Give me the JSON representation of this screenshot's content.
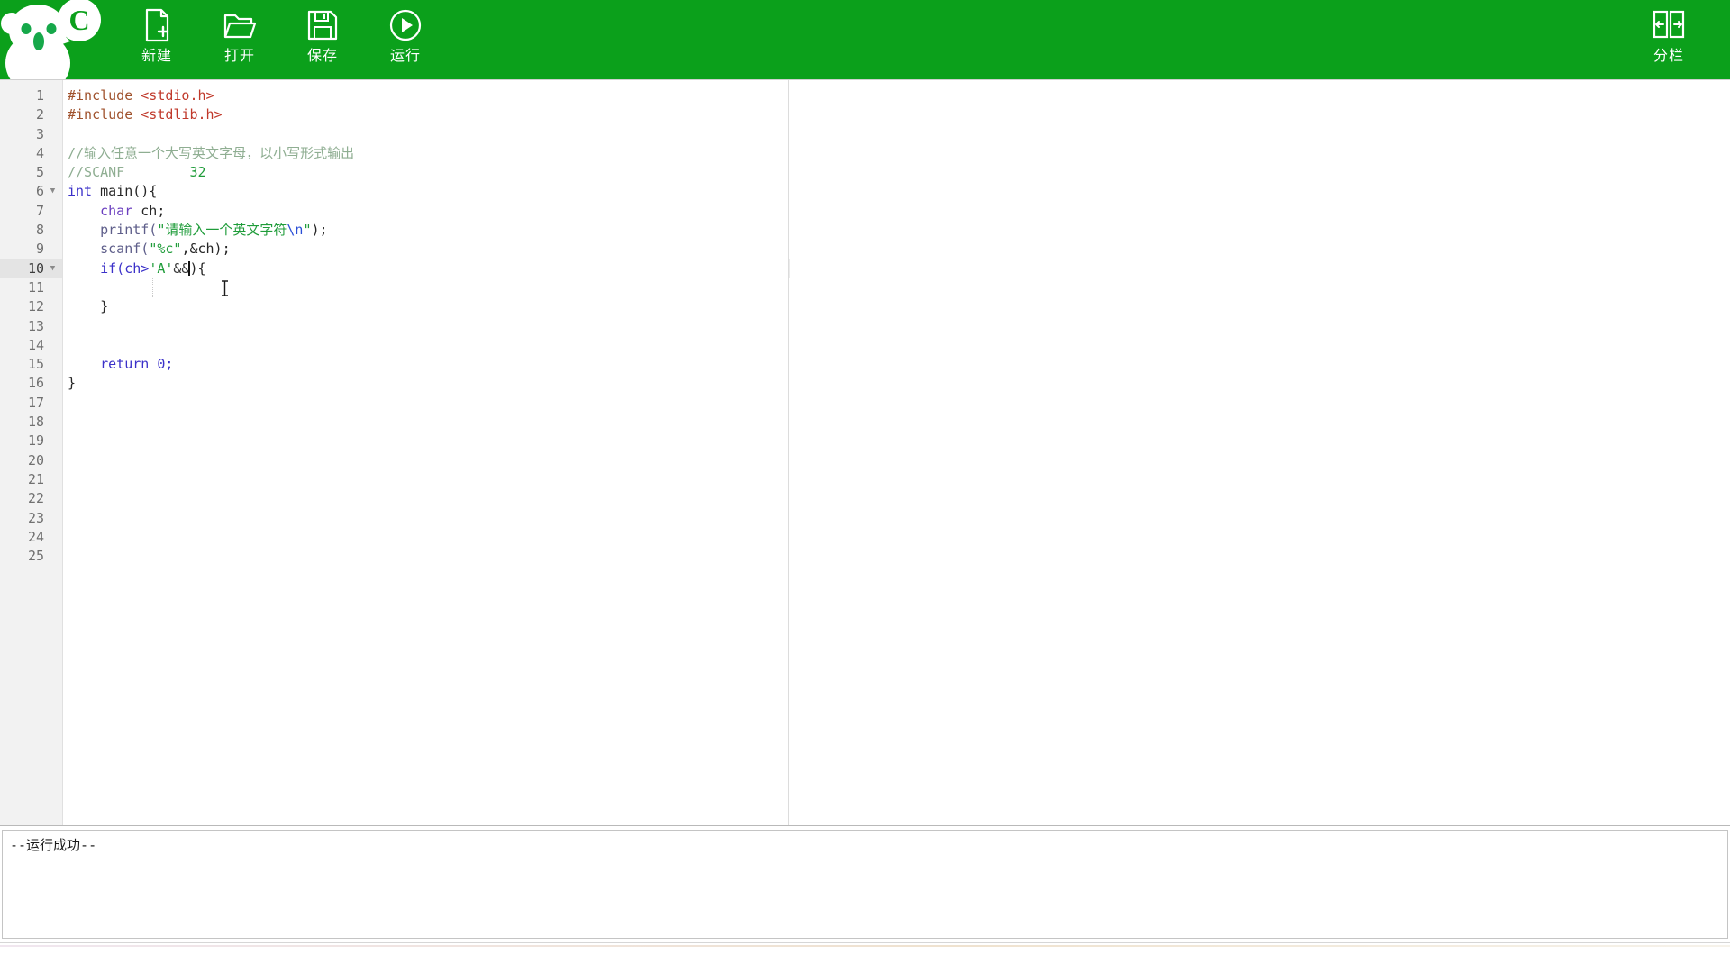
{
  "app": {
    "logo_alt": "c-mascot-logo",
    "toolbar_bg": "#0ba01b"
  },
  "toolbar": {
    "buttons": [
      {
        "id": "new",
        "label": "新建",
        "icon": "new-file-icon"
      },
      {
        "id": "open",
        "label": "打开",
        "icon": "open-folder-icon"
      },
      {
        "id": "save",
        "label": "保存",
        "icon": "floppy-save-icon"
      },
      {
        "id": "run",
        "label": "运行",
        "icon": "play-run-icon"
      }
    ],
    "split": {
      "id": "split",
      "label": "分栏",
      "icon": "split-pane-icon"
    }
  },
  "editor": {
    "total_lines": 25,
    "current_line": 10,
    "fold_lines": [
      6,
      10
    ],
    "line_numbers": [
      "1",
      "2",
      "3",
      "4",
      "5",
      "6",
      "7",
      "8",
      "9",
      "10",
      "11",
      "12",
      "13",
      "14",
      "15",
      "16",
      "17",
      "18",
      "19",
      "20",
      "21",
      "22",
      "23",
      "24",
      "25"
    ],
    "code": {
      "l1": "#include",
      "l1b": " <stdio.h>",
      "l2": "#include",
      "l2b": " <stdlib.h>",
      "l4": "//输入任意一个大写英文字母，以小写形式输出",
      "l5a": "//SCANF",
      "l5b": "32",
      "l6a": "int",
      "l6b": " main(){",
      "l7a": "char",
      "l7b": " ch;",
      "l8a": "printf(",
      "l8b": "\"请输入一个英文字符",
      "l8c": "\\n",
      "l8d": "\"",
      "l8e": ");",
      "l9a": "scanf(",
      "l9b": "\"%c\"",
      "l9c": ",&ch);",
      "l10a": "if(ch>",
      "l10b": "'A'",
      "l10c": "&&",
      "l10d": "){",
      "l12": "}",
      "l15a": "return",
      "l15b": " 0;",
      "l16": "}"
    },
    "colors": {
      "preprocessor": "#a0522d",
      "header": "#c0392b",
      "keyword": "#3b31c9",
      "string": "#1f9c3a",
      "comment": "#8fae92",
      "escape": "#2b4fd6",
      "current_line_bg": "#ebebeb",
      "gutter_bg": "#f2f2f2"
    }
  },
  "output": {
    "text": "--运行成功--"
  }
}
